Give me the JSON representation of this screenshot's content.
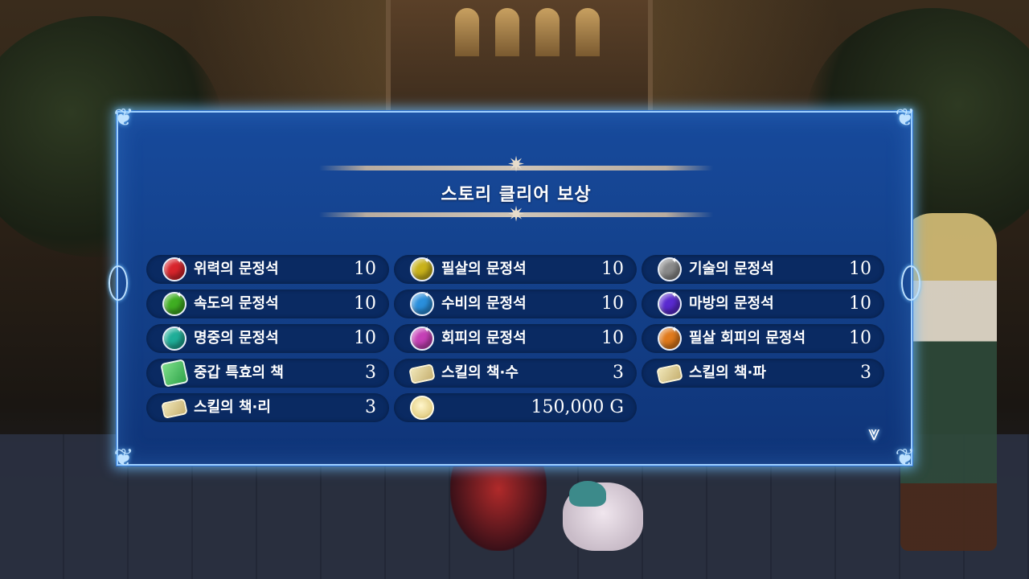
{
  "panel": {
    "title": "스토리 클리어 보상"
  },
  "rewards": [
    {
      "name": "위력의 문정석",
      "qty": "10",
      "icon": "red-gem-icon",
      "color": "#d8252c"
    },
    {
      "name": "필살의 문정석",
      "qty": "10",
      "icon": "yellow-gem-icon",
      "color": "#c9b21a"
    },
    {
      "name": "기술의 문정석",
      "qty": "10",
      "icon": "gray-gem-icon",
      "color": "#8a8a8a"
    },
    {
      "name": "속도의 문정석",
      "qty": "10",
      "icon": "green-gem-icon",
      "color": "#3fae22"
    },
    {
      "name": "수비의 문정석",
      "qty": "10",
      "icon": "blue-gem-icon",
      "color": "#2a8fdc"
    },
    {
      "name": "마방의 문정석",
      "qty": "10",
      "icon": "purple-gem-icon",
      "color": "#5a2ad0"
    },
    {
      "name": "명중의 문정석",
      "qty": "10",
      "icon": "teal-gem-icon",
      "color": "#1fae98"
    },
    {
      "name": "회피의 문정석",
      "qty": "10",
      "icon": "pink-gem-icon",
      "color": "#c53fb6"
    },
    {
      "name": "필살 회피의 문정석",
      "qty": "10",
      "icon": "orange-gem-icon",
      "color": "#e07a1c"
    },
    {
      "name": "중갑 특효의 책",
      "qty": "3",
      "icon": "green-book-icon"
    },
    {
      "name": "스킬의 책·수",
      "qty": "3",
      "icon": "scroll-book-icon"
    },
    {
      "name": "스킬의 책·파",
      "qty": "3",
      "icon": "scroll-book-icon"
    },
    {
      "name": "스킬의 책·리",
      "qty": "3",
      "icon": "scroll-book-icon"
    }
  ],
  "gold": {
    "amount": "150,000 G",
    "icon": "gold-coin-icon"
  },
  "next_icon": "chevron-down-icon"
}
